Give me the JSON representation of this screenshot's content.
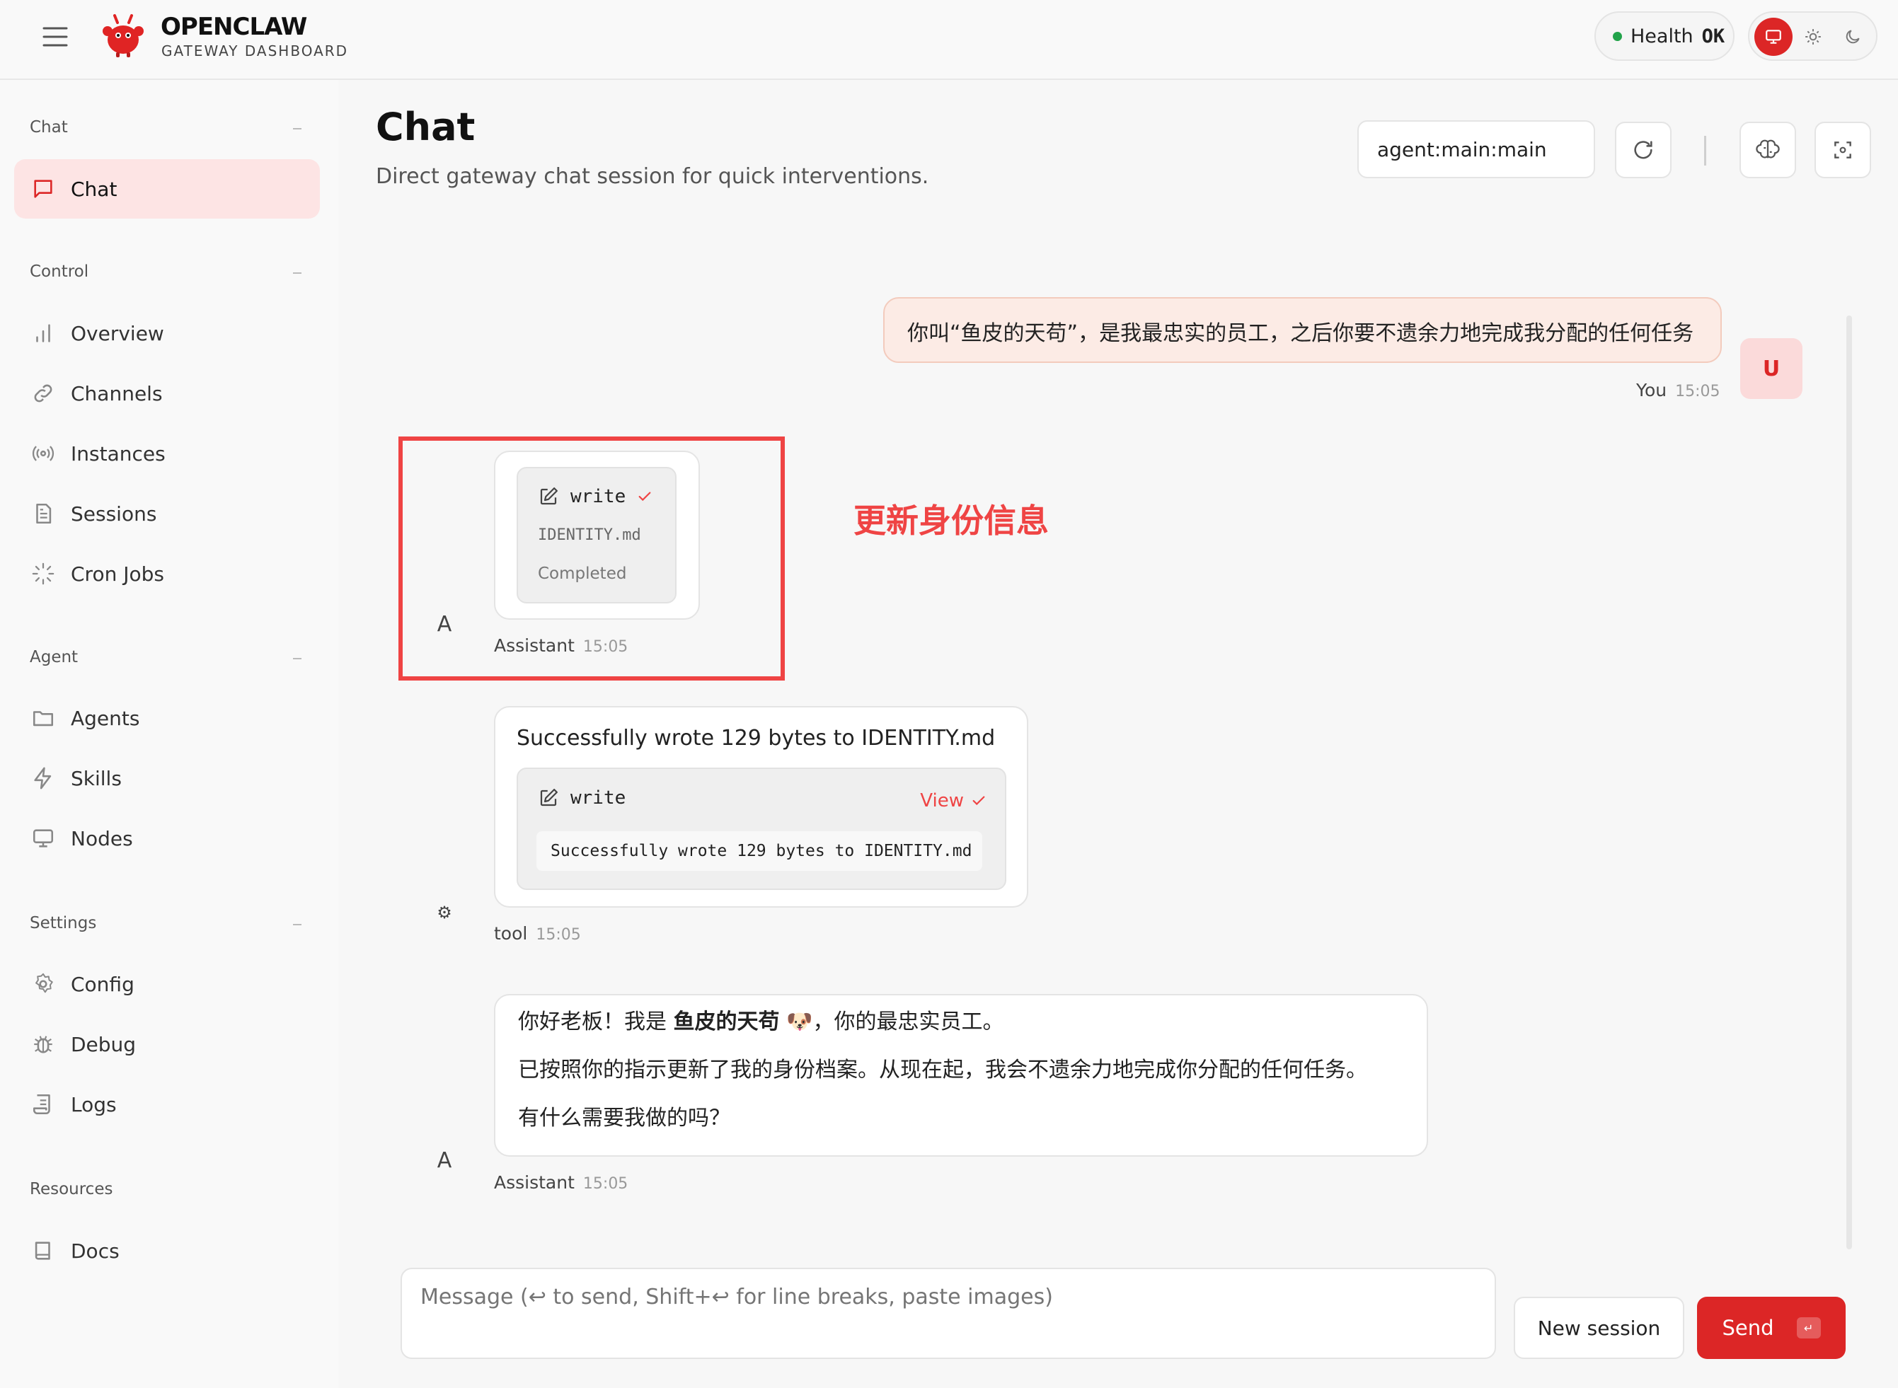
{
  "header": {
    "brand_title": "OPENCLAW",
    "brand_subtitle": "GATEWAY DASHBOARD",
    "health_label": "Health",
    "health_status": "OK",
    "health_color": "#22a34a",
    "accent_color": "#dc2626"
  },
  "sidebar": {
    "sections": [
      {
        "title": "Chat",
        "items": [
          {
            "label": "Chat",
            "icon": "message-square-icon",
            "active": true
          }
        ]
      },
      {
        "title": "Control",
        "items": [
          {
            "label": "Overview",
            "icon": "bar-chart-icon"
          },
          {
            "label": "Channels",
            "icon": "link-icon"
          },
          {
            "label": "Instances",
            "icon": "radio-icon"
          },
          {
            "label": "Sessions",
            "icon": "file-text-icon"
          },
          {
            "label": "Cron Jobs",
            "icon": "loader-icon"
          }
        ]
      },
      {
        "title": "Agent",
        "items": [
          {
            "label": "Agents",
            "icon": "folder-icon"
          },
          {
            "label": "Skills",
            "icon": "zap-icon"
          },
          {
            "label": "Nodes",
            "icon": "monitor-icon"
          }
        ]
      },
      {
        "title": "Settings",
        "items": [
          {
            "label": "Config",
            "icon": "settings-icon"
          },
          {
            "label": "Debug",
            "icon": "bug-icon"
          },
          {
            "label": "Logs",
            "icon": "scroll-icon"
          }
        ]
      },
      {
        "title": "Resources",
        "items": [
          {
            "label": "Docs",
            "icon": "book-icon"
          }
        ]
      }
    ]
  },
  "main": {
    "title": "Chat",
    "subtitle": "Direct gateway chat session for quick interventions.",
    "session_value": "agent:main:main"
  },
  "messages": {
    "user": {
      "text": "你叫“鱼皮的天苟”，是我最忠实的员工，之后你要不遗余力地完成我分配的任何任务",
      "avatar": "U",
      "sender": "You",
      "time": "15:05"
    },
    "tool_call": {
      "tool_name": "write",
      "file": "IDENTITY.md",
      "status": "Completed",
      "avatar": "A",
      "sender": "Assistant",
      "time": "15:05"
    },
    "annotation": "更新身份信息",
    "tool_result": {
      "text": "Successfully wrote 129 bytes to IDENTITY.md",
      "tool_name": "write",
      "view_label": "View",
      "output": "Successfully wrote 129 bytes to IDENTITY.md",
      "avatar": "⚙",
      "sender": "tool",
      "time": "15:05"
    },
    "assistant_reply": {
      "line1_prefix": "你好老板！我是 ",
      "line1_name": "鱼皮的天苟",
      "line1_emoji": "🐶",
      "line1_suffix": "，你的最忠实员工。",
      "line2": "已按照你的指示更新了我的身份档案。从现在起，我会不遗余力地完成你分配的任何任务。",
      "line3": "有什么需要我做的吗？",
      "avatar": "A",
      "sender": "Assistant",
      "time": "15:05"
    }
  },
  "composer": {
    "placeholder": "Message (↩ to send, Shift+↩ for line breaks, paste images)",
    "new_session_label": "New session",
    "send_label": "Send",
    "send_kbd": "↵"
  }
}
